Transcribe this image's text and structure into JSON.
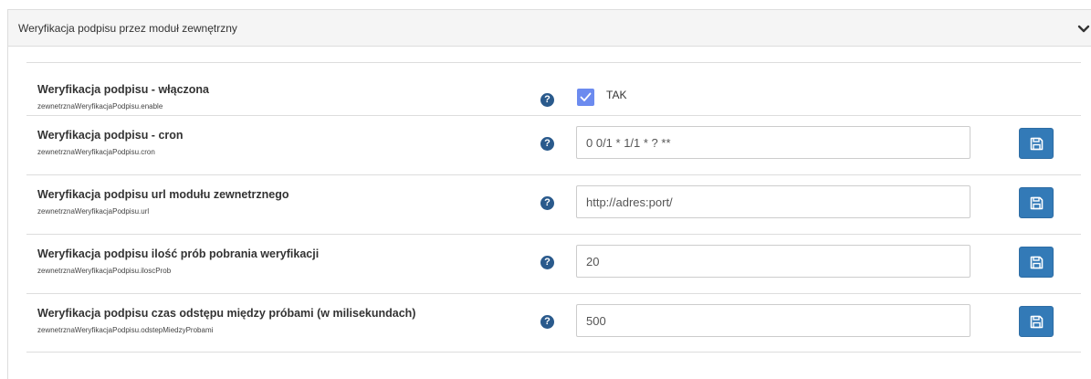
{
  "panel": {
    "title": "Weryfikacja podpisu przez moduł zewnętrzny",
    "collapse_icon": "chevron-down-icon"
  },
  "settings": [
    {
      "label": "Weryfikacja podpisu - włączona",
      "key": "zewnetrznaWeryfikacjaPodpisu.enable",
      "type": "checkbox",
      "checked": true,
      "check_label": "TAK",
      "help_icon": "?"
    },
    {
      "label": "Weryfikacja podpisu - cron",
      "key": "zewnetrznaWeryfikacjaPodpisu.cron",
      "type": "text",
      "value": "0 0/1 * 1/1 * ? **",
      "help_icon": "?"
    },
    {
      "label": "Weryfikacja podpisu url modułu zewnetrznego",
      "key": "zewnetrznaWeryfikacjaPodpisu.url",
      "type": "text",
      "value": "http://adres:port/",
      "help_icon": "?"
    },
    {
      "label": "Weryfikacja podpisu ilość prób pobrania weryfikacji",
      "key": "zewnetrznaWeryfikacjaPodpisu.iloscProb",
      "type": "text",
      "value": "20",
      "help_icon": "?"
    },
    {
      "label": "Weryfikacja podpisu czas odstępu między próbami (w milisekundach)",
      "key": "zewnetrznaWeryfikacjaPodpisu.odstepMiedzyProbami",
      "type": "text",
      "value": "500",
      "help_icon": "?"
    }
  ],
  "colors": {
    "checkbox": "#6c8bef",
    "save_button": "#337ab7",
    "help_icon": "#2a5a8c"
  }
}
